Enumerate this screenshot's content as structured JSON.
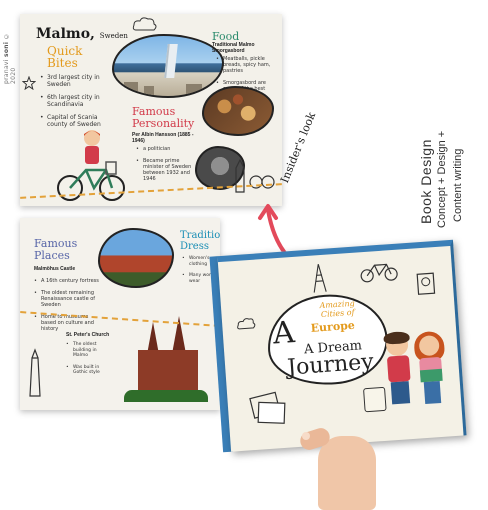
{
  "credit": {
    "prefix": "pranavi",
    "name": "soni",
    "year": "© 2020"
  },
  "top_page": {
    "city": "Malmo,",
    "country": "Sweden",
    "quick_bites_title": "Quick Bites",
    "quick_bites": [
      "3rd largest city in Sweden",
      "6th largest city in Scandinavia",
      "Capital of Scania county of Sweden"
    ],
    "food_title": "Food",
    "food_subtitle": "Traditional Malmo Smorgasbord",
    "food_items": [
      "Meatballs, pickle breads, spicy ham, pastries",
      "Smorgasbord are some of the best"
    ],
    "personality_title": "Famous Personality",
    "personality_name": "Per Albin Hansson (1885 - 1946)",
    "personality_facts": [
      "a politician",
      "Became prime minister of Sweden between 1932 and 1946"
    ]
  },
  "bottom_page": {
    "places_title": "Famous Places",
    "castle_title": "Malmöhus Castle",
    "castle_facts": [
      "A 16th century fortress",
      "The oldest remaining Renaissance castle of Sweden",
      "Home to museums based on culture and history"
    ],
    "dress_title": "Traditional Dress",
    "dress_facts": [
      "Women's clothing",
      "Many women wear"
    ],
    "church_title": "St. Peter's Church",
    "church_facts": [
      "The oldest building in Malmo",
      "Was built in Gothic style"
    ]
  },
  "insider_label": "Insider's look",
  "side_labels": {
    "book_design": "Book Design",
    "concept": "Concept + Design +",
    "content_writing": "Content writing"
  },
  "cover": {
    "tagline_1": "Amazing",
    "tagline_2": "Cities of",
    "europe": "Europe",
    "a": "A",
    "dream": "A Dream",
    "journey": "Journey"
  },
  "colors": {
    "orange": "#e39a1c",
    "red": "#d23b4a",
    "green": "#2a8a6c",
    "blue": "#3a7fb8",
    "purple": "#5866a8",
    "teal": "#1a8eb5",
    "arrow": "#e34a5b"
  }
}
